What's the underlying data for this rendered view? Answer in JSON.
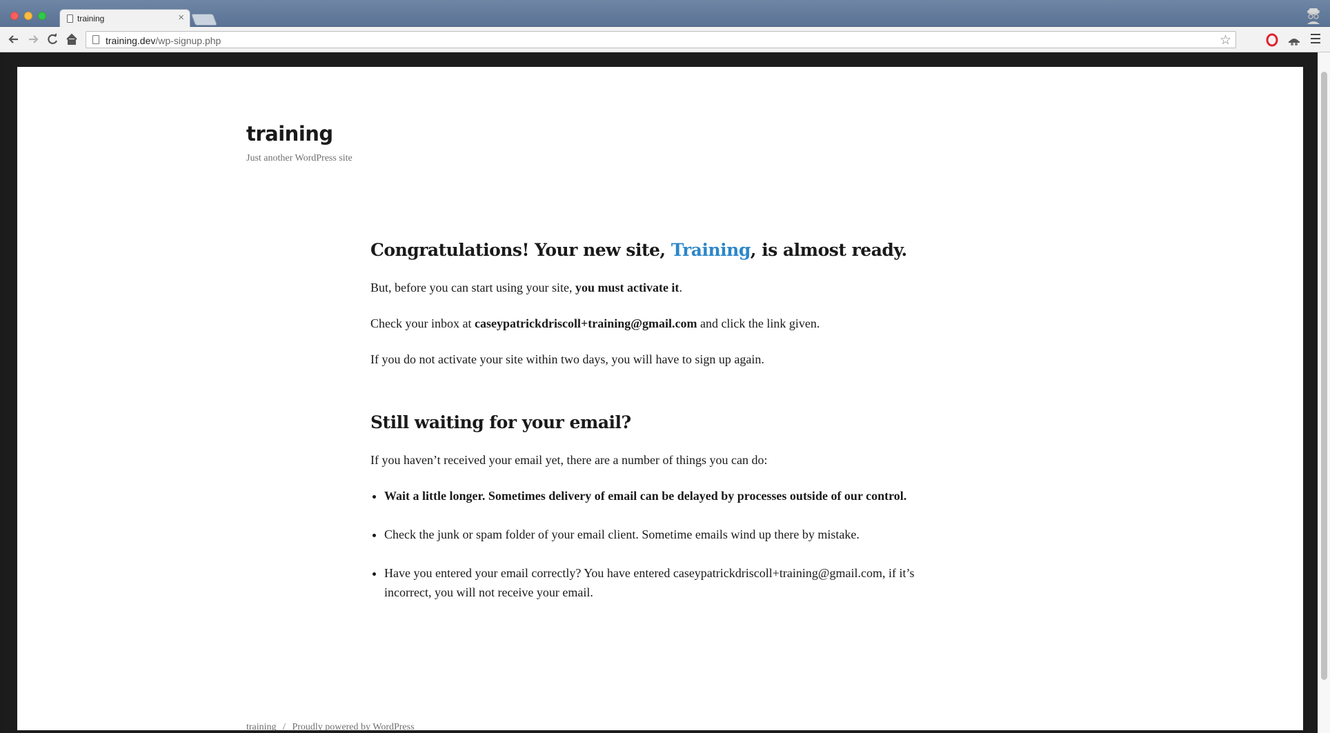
{
  "browser": {
    "tab_title": "training",
    "tab_close": "×",
    "url_domain": "training.dev",
    "url_path": "/wp-signup.php"
  },
  "site": {
    "title": "training",
    "description": "Just another WordPress site"
  },
  "content": {
    "heading1_before": "Congratulations! Your new site, ",
    "heading1_link": "Training",
    "heading1_after": ", is almost ready.",
    "p1_before": "But, before you can start using your site, ",
    "p1_bold": "you must activate it",
    "p1_after": ".",
    "p2_before": "Check your inbox at ",
    "p2_email": "caseypatrickdriscoll+training@gmail.com",
    "p2_after": " and click the link given.",
    "p3": "If you do not activate your site within two days, you will have to sign up again.",
    "heading2": "Still waiting for your email?",
    "p4": "If you haven’t received your email yet, there are a number of things you can do:",
    "list": [
      "Wait a little longer. Sometimes delivery of email can be delayed by processes outside of our control.",
      "Check the junk or spam folder of your email client. Sometime emails wind up there by mistake.",
      "Have you entered your email correctly? You have entered caseypatrickdriscoll+training@gmail.com, if it’s incorrect, you will not receive your email."
    ]
  },
  "footer": {
    "site_link": "training",
    "separator": "/",
    "powered": "Proudly powered by WordPress"
  }
}
